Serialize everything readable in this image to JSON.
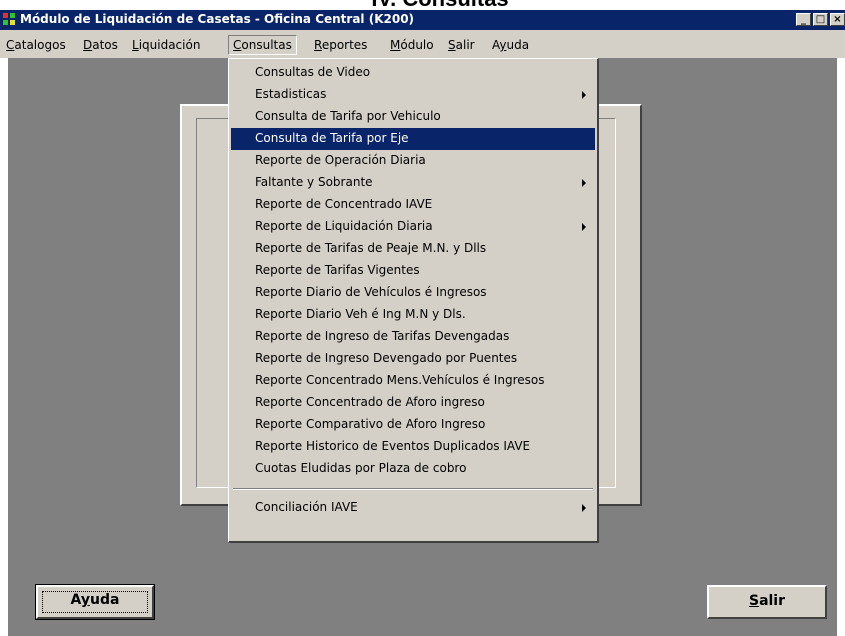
{
  "document": {
    "heading": "IV. Consultas"
  },
  "window": {
    "title": "Módulo de Liquidación de Casetas - Oficina Central (K200)",
    "controls": {
      "minimize": "_",
      "maximize": "□",
      "close": "×"
    }
  },
  "menubar": {
    "items": [
      {
        "label": "Catalogos",
        "mnemonic": "C"
      },
      {
        "label": "Datos",
        "mnemonic": "D"
      },
      {
        "label": "Liquidación",
        "mnemonic": "L"
      },
      {
        "label": "Consultas",
        "mnemonic": "C",
        "open": true
      },
      {
        "label": "Reportes",
        "mnemonic": "R"
      },
      {
        "label": "Módulo",
        "mnemonic": "M"
      },
      {
        "label": "Salir",
        "mnemonic": "S"
      },
      {
        "label": "Ayuda",
        "mnemonic": "y"
      }
    ]
  },
  "consultas_menu": {
    "items": [
      {
        "label": "Consultas de Video",
        "submenu": false
      },
      {
        "label": "Estadisticas",
        "submenu": true
      },
      {
        "label": "Consulta de Tarifa por Vehiculo",
        "submenu": false
      },
      {
        "label": "Consulta de Tarifa por Eje",
        "submenu": false,
        "highlighted": true
      },
      {
        "label": "Reporte de Operación Diaria",
        "submenu": false
      },
      {
        "label": "Faltante y Sobrante",
        "submenu": true
      },
      {
        "label": "Reporte de Concentrado IAVE",
        "submenu": false
      },
      {
        "label": "Reporte de Liquidación Diaria",
        "submenu": true
      },
      {
        "label": "Reporte de Tarifas de Peaje M.N. y Dlls",
        "submenu": false
      },
      {
        "label": "Reporte de Tarifas Vigentes",
        "submenu": false
      },
      {
        "label": "Reporte Diario de Vehículos é Ingresos",
        "submenu": false
      },
      {
        "label": "Reporte Diario Veh é Ing M.N y Dls.",
        "submenu": false
      },
      {
        "label": "Reporte de Ingreso de Tarifas Devengadas",
        "submenu": false
      },
      {
        "label": "Reporte de Ingreso Devengado por Puentes",
        "submenu": false
      },
      {
        "label": "Reporte Concentrado Mens.Vehículos é Ingresos",
        "submenu": false
      },
      {
        "label": "Reporte Concentrado de Aforo ingreso",
        "submenu": false
      },
      {
        "label": "Reporte Comparativo de Aforo Ingreso",
        "submenu": false
      },
      {
        "label": "Reporte Historico de Eventos Duplicados IAVE",
        "submenu": false
      },
      {
        "label": "Cuotas Eludidas por Plaza de cobro",
        "submenu": false
      },
      {
        "label": "Conciliación IAVE",
        "submenu": true
      }
    ]
  },
  "buttons": {
    "ayuda": {
      "label": "Ayuda",
      "mnemonic": "y"
    },
    "salir": {
      "label": "Salir",
      "mnemonic": "S"
    }
  },
  "colors": {
    "titlebar": "#0a246a",
    "face": "#d4d0c8",
    "workspace": "#808080",
    "highlight": "#0a246a"
  },
  "icons": [
    "app-icon",
    "minimize-icon",
    "maximize-icon",
    "close-icon",
    "submenu-arrow-icon"
  ]
}
